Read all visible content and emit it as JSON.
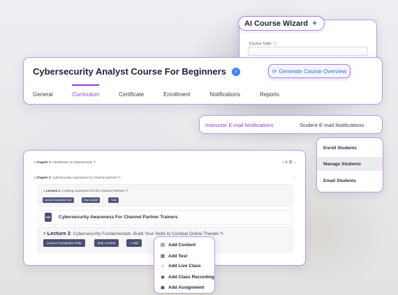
{
  "ai_wizard": {
    "title": "AI Course Wizard",
    "topic_label": "Course Topic ⓘ"
  },
  "course": {
    "title": "Cybersecurity Analyst Course For Beginners",
    "generate_label": "Generate Course Overview",
    "tabs": [
      {
        "label": "General",
        "active": false
      },
      {
        "label": "Curriculum",
        "active": true
      },
      {
        "label": "Certificate",
        "active": false
      },
      {
        "label": "Enrollment",
        "active": false
      },
      {
        "label": "Notifications",
        "active": false
      },
      {
        "label": "Reports",
        "active": false
      }
    ]
  },
  "notifications": {
    "instructor": "Instructor E-mail Notifications",
    "student": "Student E-mail Notifications"
  },
  "students_menu": {
    "enroll": "Enroll Students",
    "manage": "Manage Students",
    "email": "Email Students"
  },
  "curriculum": {
    "chapter1": {
      "prefix": "Chapter 1",
      "title": ": Introduction of Cybersecurity"
    },
    "chapter2": {
      "prefix": "Chapter 2",
      "title": ": Cybersecurity Awareness for Channel partners"
    },
    "lecture1": {
      "prefix": "Lecture 1",
      "title": ": Creating Awareness for the Channel Partners",
      "buttons": [
        "Lecture Completion Rule",
        "Drip Content",
        "+ Add"
      ]
    },
    "pdf": {
      "badge": "PDF",
      "title": "Cybersecurity Awareness For Channel Partner Trainers"
    },
    "lecture2": {
      "prefix": "Lecture 2",
      "title": ": Cybersecurity Fundamentals: Build Your Skills to Combat Online Threats",
      "buttons": [
        "Lecture Completion Rule",
        "Drip Content",
        "+ Add"
      ]
    }
  },
  "add_menu": [
    {
      "label": "Add Content",
      "icon": "document-icon"
    },
    {
      "label": "Add Test",
      "icon": "test-icon"
    },
    {
      "label": "Add Live Class",
      "icon": "microphone-icon"
    },
    {
      "label": "Add Class Recording",
      "icon": "camera-icon"
    },
    {
      "label": "Add Assignment",
      "icon": "assignment-icon"
    }
  ],
  "colors": {
    "accent": "#8b3fd8",
    "blue": "#3b6fe0",
    "border": "#b99ae0"
  }
}
